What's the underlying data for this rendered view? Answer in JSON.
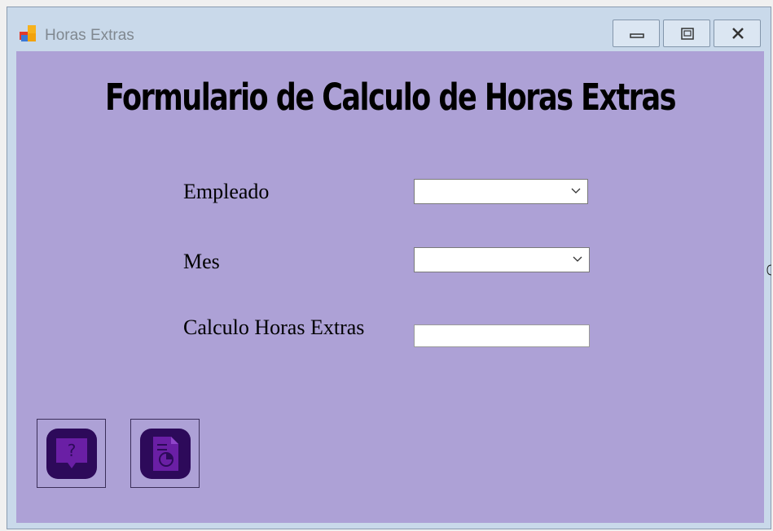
{
  "window": {
    "title": "Horas Extras",
    "controls": [
      "minimize-icon",
      "maximize-icon",
      "close-icon"
    ]
  },
  "form": {
    "heading": "Formulario de Calculo de Horas Extras",
    "fields": {
      "empleado": {
        "label": "Empleado",
        "value": ""
      },
      "mes": {
        "label": "Mes",
        "value": ""
      },
      "calculo": {
        "label": "Calculo Horas Extras",
        "value": ""
      }
    },
    "buttons": {
      "help": {
        "icon": "help-chat-icon"
      },
      "report": {
        "icon": "report-document-icon"
      }
    }
  },
  "colors": {
    "client_background": "#ada1d6",
    "icon_dark": "#2d0a5a",
    "icon_accent": "#6a1fa5"
  }
}
